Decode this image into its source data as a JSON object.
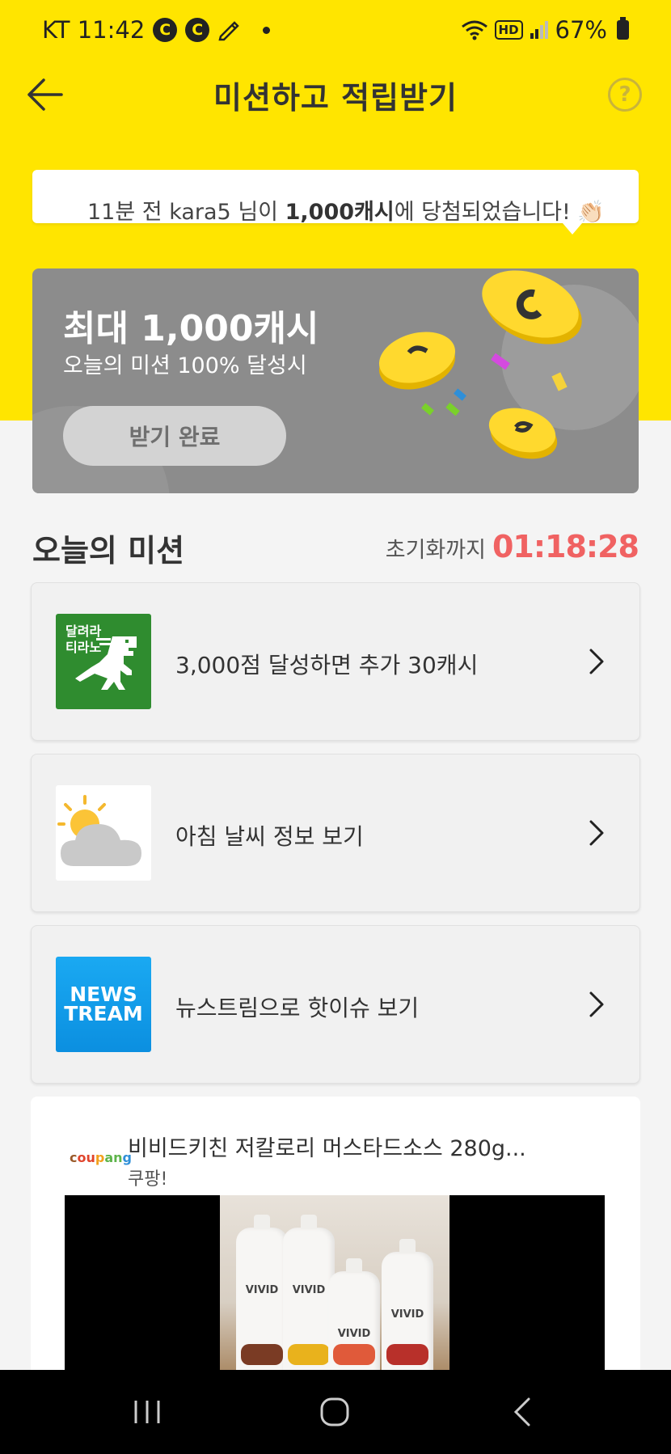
{
  "status_bar": {
    "carrier_time": "KT 11:42",
    "icon1": "C",
    "icon2": "C",
    "hd": "HD",
    "battery": "67%"
  },
  "header": {
    "title": "미션하고 적립받기",
    "help": "?"
  },
  "ticker": {
    "prefix": "11분 전 kara5",
    "middle": "님이",
    "amount": "1,000캐시",
    "suffix": "에 당첨되었습니다! 👏🏻"
  },
  "banner": {
    "title": "최대 1,000캐시",
    "subtitle": "오늘의 미션 100% 달성시",
    "button": "받기 완료"
  },
  "missions_section": {
    "title": "오늘의 미션",
    "reset_label": "초기화까지",
    "reset_time": "01:18:28"
  },
  "missions": [
    {
      "thumb_text_line1": "달려라",
      "thumb_text_line2": "티라노",
      "label": "3,000점 달성하면 추가 30캐시",
      "icon": "dinosaur-icon"
    },
    {
      "label": "아침 날씨 정보 보기",
      "icon": "weather-icon"
    },
    {
      "thumb_text_line1": "NEWS",
      "thumb_text_line2": "TREAM",
      "label": "뉴스트림으로 핫이슈 보기",
      "icon": "newstream-logo"
    }
  ],
  "ad": {
    "logo": [
      "c",
      "ou",
      "p",
      "an",
      "g"
    ],
    "title": "비비드키친 저칼로리 머스타드소스 280g...",
    "source": "쿠팡!",
    "bottle_brand": "VIVID"
  },
  "colors": {
    "header_bg": "#ffe500",
    "timer": "#f06262",
    "banner_bg": "#8c8c8c"
  }
}
